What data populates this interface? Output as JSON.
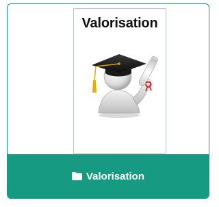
{
  "card": {
    "thumbnail_title": "Valorisation",
    "footer_label": "Valorisation",
    "footer_icon": "folder-icon",
    "thumbnail_image": "graduate-with-diploma-illustration"
  },
  "colors": {
    "accent": "#179a82",
    "thumbnail_border": "#b9c7e6"
  }
}
